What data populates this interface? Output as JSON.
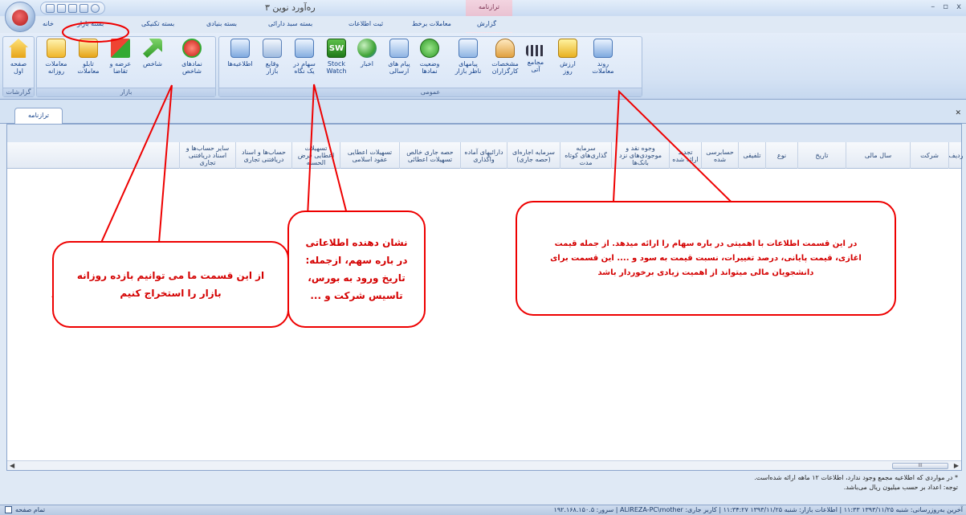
{
  "window": {
    "title": "ره‌آورد نوین ۳",
    "context_tab": "ترازنامه",
    "controls": [
      "–",
      "▫",
      "x"
    ]
  },
  "tabs": [
    {
      "label": "خانه"
    },
    {
      "label": "بسته بازار"
    },
    {
      "label": "بسته تکنیکی"
    },
    {
      "label": "بسته بنیادی"
    },
    {
      "label": "بسته سبد دارائی"
    },
    {
      "label": "ثبت اطلاعات"
    },
    {
      "label": "معاملات برخط"
    },
    {
      "label": "گزارش"
    }
  ],
  "ribbon": {
    "groups": [
      {
        "title": "گزارشات",
        "buttons": [
          {
            "label": "صفحه اول",
            "icon": "home-icon"
          }
        ]
      },
      {
        "title": "بازار",
        "buttons": [
          {
            "label": "معاملات روزانه",
            "icon": "daily-trades-icon"
          },
          {
            "label": "تابلو معاملات",
            "icon": "trade-board-icon"
          },
          {
            "label": "عرضه و تقاضا",
            "icon": "supply-demand-icon"
          },
          {
            "label": "شاخص",
            "icon": "index-up-icon"
          },
          {
            "label": "نمادهای شاخص",
            "icon": "index-symbols-icon"
          }
        ]
      },
      {
        "title": "عمومی",
        "buttons": [
          {
            "label": "اطلاعیه‌ها",
            "icon": "announcements-icon"
          },
          {
            "label": "وقایع بازار",
            "icon": "market-events-icon"
          },
          {
            "label": "سهام در یک نگاه",
            "icon": "stock-glance-icon"
          },
          {
            "label": "Stock Watch",
            "icon": "stock-watch-icon"
          },
          {
            "label": "اخبار",
            "icon": "news-icon"
          },
          {
            "label": "پیام های ارسالی",
            "icon": "sent-messages-icon"
          },
          {
            "label": "وضعیت نمادها",
            "icon": "symbol-status-icon"
          },
          {
            "label": "پیامهای ناظر بازار",
            "icon": "supervisor-messages-icon"
          },
          {
            "label": "مشخصات کارگزاران",
            "icon": "brokers-icon"
          },
          {
            "label": "مجامع آتی",
            "icon": "assemblies-icon"
          },
          {
            "label": "ارزش روز",
            "icon": "daily-value-icon"
          },
          {
            "label": "روند معاملات",
            "icon": "trade-trend-icon"
          }
        ]
      }
    ]
  },
  "document": {
    "tab": "ترازنامه",
    "columns": [
      "ردیف",
      "شرکت",
      "سال مالی",
      "تاریخ",
      "نوع",
      "تلفیقی",
      "حسابرسی شده",
      "تجدید ارائه شده",
      "وجوه نقد و موجودی‌های نزد بانک‌ها",
      "سرمایه گذاری‌های کوتاه مدت",
      "سرمایه اجاره‌ای (حصه جاری)",
      "دارائیهای آماده واگذاری",
      "حصه جاری خالص تسهیلات اعطائی",
      "تسهیلات اعطایی عقود اسلامی",
      "تسهیلات اعطایی قرض الحسنه",
      "حساب‌ها و اسناد دریافتنی تجاری",
      "سایر حساب‌ها و اسناد دریافتنی تجاری"
    ],
    "scrollbar_thumb": "III"
  },
  "notes": [
    "* در مواردی که اطلاعیه مجمع وجود ندارد، اطلاعات ۱۲ ماهه ارائه شده‌است.",
    "توجه: اعداد بر حسب میلیون ریال می‌باشد."
  ],
  "status": {
    "fullscreen": "تمام صفحه",
    "right": "آخرین به‌روزرسانی: شنبه ۱۳۹۳/۱۱/۲۵ ۱۱:۳۳ | اطلاعات بازار: شنبه ۱۳۹۳/۱۱/۲۵ ۱۱:۳۴:۲۷ | کاربر جاری: ALIREZA-PC\\mother | سرور: ۱۹۲.۱۶۸.۱۵۰.۵"
  },
  "callouts": {
    "left": "از این قسمت ما می توانیم بازده روزانه بازار را استخراج کنیم",
    "middle": "نشان دهنده اطلاعاتی در باره سهم، ازجمله: تاریخ ورود به بورس، تاسیس شرکت و ...",
    "right": "در این قسمت اطلاعات با اهمیتی در باره سهام را ارائه میدهد. از جمله قیمت اغازی، قیمت پایانی، درصد تغییرات، نسبت قیمت به سود و .... این قسمت برای دانشجویان مالی میتواند از اهمیت زیادی برخوردار باشد"
  },
  "colors": {
    "accent": "#15428b",
    "annotation": "#e00000"
  }
}
